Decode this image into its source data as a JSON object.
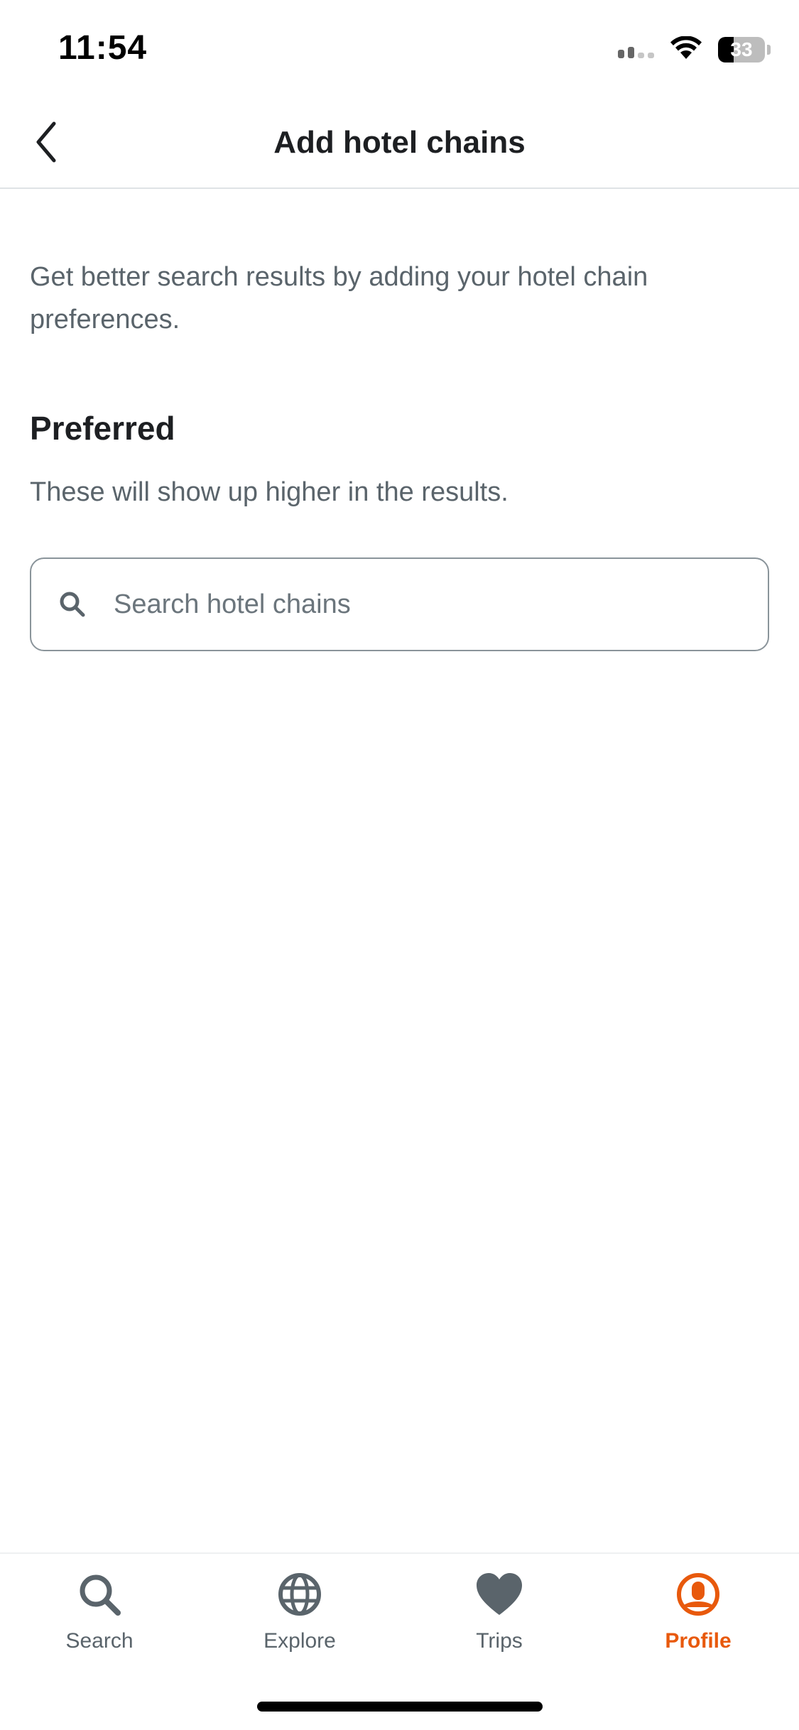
{
  "status_bar": {
    "time": "11:54",
    "battery_percent": "33",
    "battery_level": 0.33
  },
  "header": {
    "title": "Add hotel chains",
    "back_icon": "chevron-left-icon"
  },
  "intro": {
    "text": "Get better search results by adding your hotel chain preferences."
  },
  "preferred": {
    "heading": "Preferred",
    "description": "These will show up higher in the results."
  },
  "search": {
    "placeholder": "Search hotel chains",
    "value": "",
    "icon": "search-icon"
  },
  "tab_bar": {
    "tabs": [
      {
        "label": "Search",
        "icon": "search-icon",
        "active": false
      },
      {
        "label": "Explore",
        "icon": "globe-icon",
        "active": false
      },
      {
        "label": "Trips",
        "icon": "heart-icon",
        "active": false
      },
      {
        "label": "Profile",
        "icon": "profile-icon",
        "active": true
      }
    ]
  },
  "colors": {
    "accent": "#e8590c",
    "text_primary": "#1d1f22",
    "text_secondary": "#5a646b",
    "icon_inactive": "#5a646b",
    "border": "#8a949a"
  }
}
